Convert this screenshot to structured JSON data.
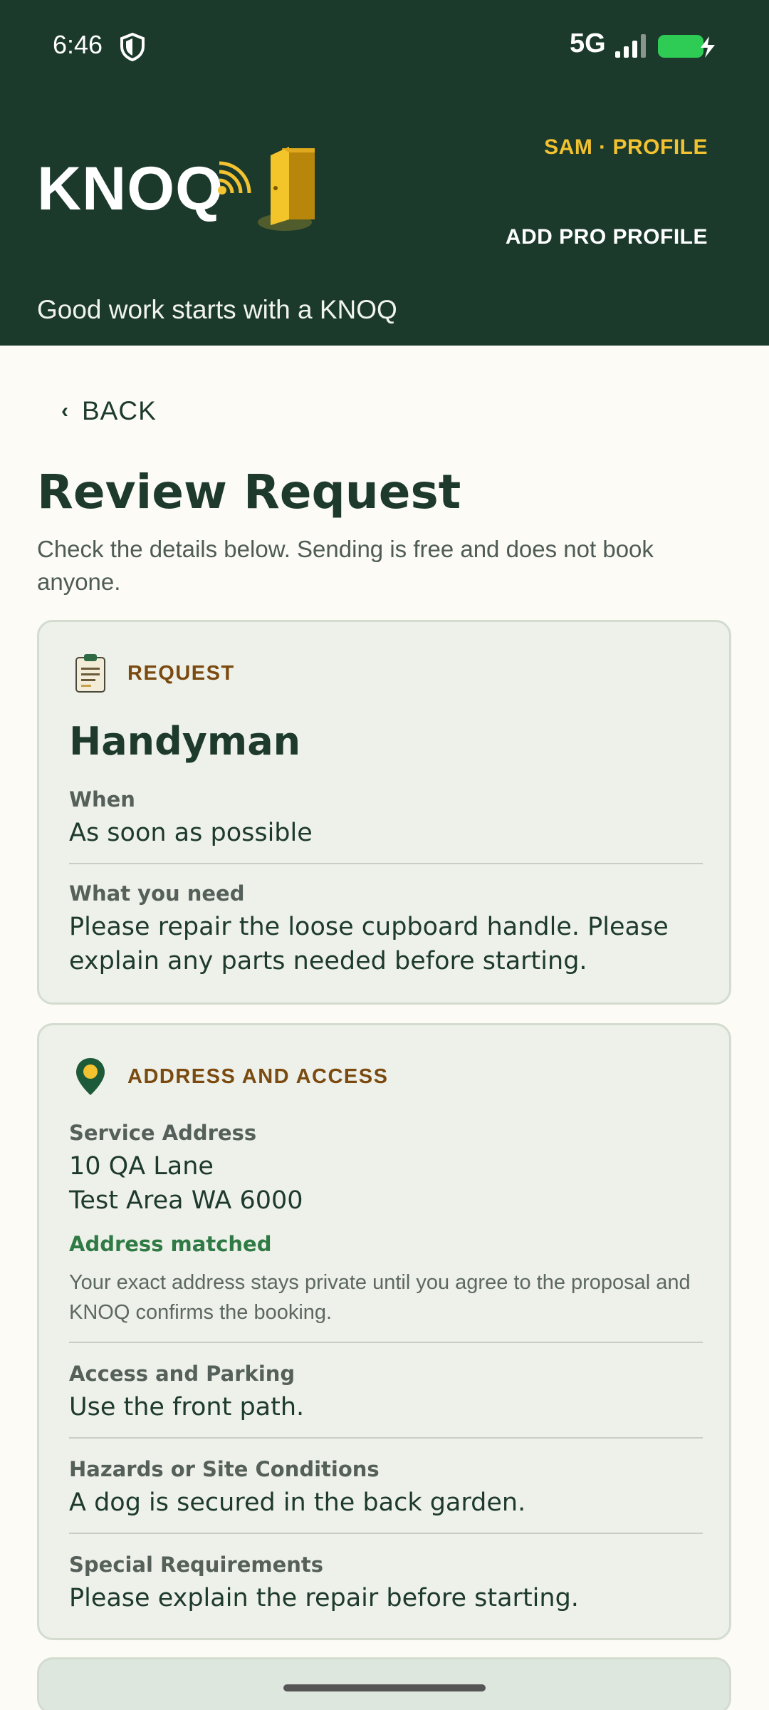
{
  "status_bar": {
    "time": "6:46",
    "network": "5G",
    "icons": [
      "shield-icon",
      "signal-icon",
      "battery-charging-icon"
    ]
  },
  "header": {
    "logo_text": "KNOQ",
    "profile_link": "SAM · PROFILE",
    "pro_link": "ADD PRO PROFILE",
    "tagline": "Good work starts with a KNOQ"
  },
  "nav": {
    "back_label": "BACK"
  },
  "page": {
    "title": "Review Request",
    "subtitle": "Check the details below. Sending is free and does not book anyone."
  },
  "request_card": {
    "section_label": "REQUEST",
    "service": "Handyman",
    "when_label": "When",
    "when_value": "As soon as possible",
    "need_label": "What you need",
    "need_value": "Please repair the loose cupboard handle. Please explain any parts needed before starting."
  },
  "address_card": {
    "section_label": "ADDRESS AND ACCESS",
    "address_label": "Service Address",
    "address_line1": "10 QA Lane",
    "address_line2": "Test Area WA 6000",
    "matched_label": "Address matched",
    "privacy_note": "Your exact address stays private until you agree to the proposal and KNOQ confirms the booking.",
    "access_label": "Access and Parking",
    "access_value": "Use the front path.",
    "hazards_label": "Hazards or Site Conditions",
    "hazards_value": "A dog is secured in the back garden.",
    "special_label": "Special Requirements",
    "special_value": "Please explain the repair before starting."
  },
  "colors": {
    "header_bg": "#1b3a2c",
    "accent_yellow": "#f2c230",
    "section_label": "#7a4a10",
    "matched_green": "#2f7a45"
  }
}
